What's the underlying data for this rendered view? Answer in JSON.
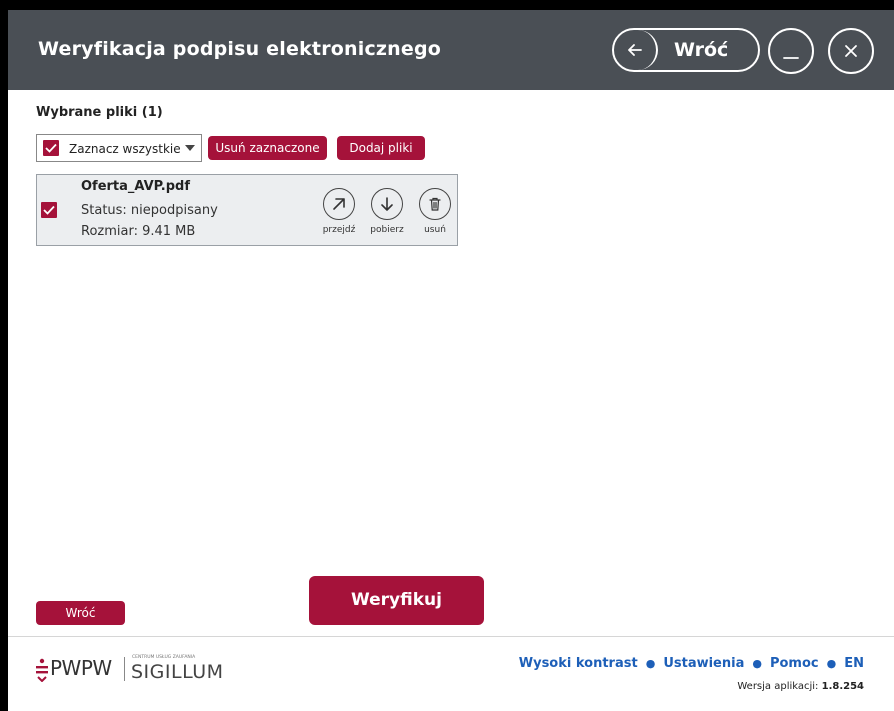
{
  "header": {
    "title": "Weryfikacja podpisu elektronicznego",
    "back_label": "Wróć",
    "bg_color": "#4a4f55"
  },
  "files_section": {
    "title": "Wybrane pliki",
    "count": "(1)",
    "select_all_label": "Zaznacz wszystkie",
    "remove_selected_label": "Usuń zaznaczone",
    "add_files_label": "Dodaj pliki"
  },
  "files": [
    {
      "name": "Oferta_AVP.pdf",
      "status": "Status: niepodpisany",
      "size": "Rozmiar: 9.41 MB",
      "checked": true,
      "actions": {
        "open": "przejdź",
        "download": "pobierz",
        "remove": "usuń"
      }
    }
  ],
  "actions": {
    "verify_label": "Weryfikuj",
    "back_label": "Wróć"
  },
  "footer": {
    "logo_left": "PWPW",
    "logo_small": "CENTRUM USŁUG ZAUFANIA",
    "logo_right": "SIGILLUM",
    "links": {
      "high_contrast": "Wysoki kontrast",
      "settings": "Ustawienia",
      "help": "Pomoc",
      "language": "EN"
    },
    "version_label": "Wersja aplikacji:",
    "version_value": "1.8.254"
  },
  "colors": {
    "accent": "#a5123a",
    "link": "#1d5fb8"
  }
}
